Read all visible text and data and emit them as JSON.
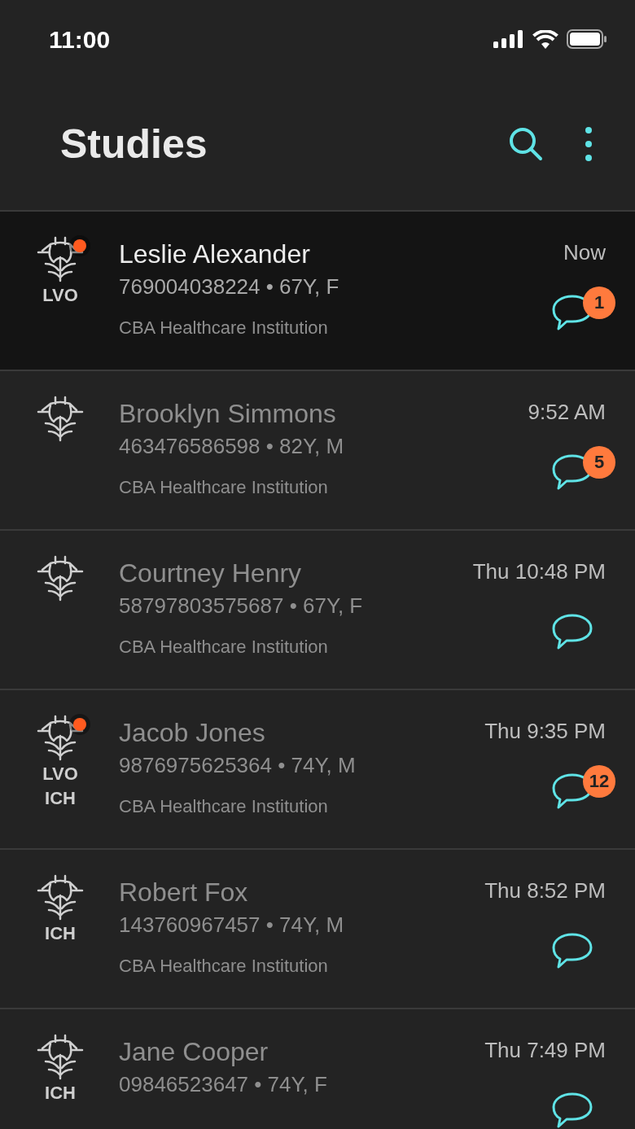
{
  "status_bar": {
    "time": "11:00"
  },
  "header": {
    "title": "Studies"
  },
  "studies": [
    {
      "name": "Leslie Alexander",
      "details": "769004038224 • 67Y, F",
      "institution": "CBA Healthcare Institution",
      "time": "Now",
      "selected": true,
      "unread": true,
      "tags": [
        "LVO"
      ],
      "message_count": "1"
    },
    {
      "name": "Brooklyn Simmons",
      "details": "463476586598 • 82Y, M",
      "institution": "CBA Healthcare Institution",
      "time": "9:52 AM",
      "selected": false,
      "unread": false,
      "message_count": "5"
    },
    {
      "name": "Courtney Henry",
      "details": "58797803575687 • 67Y, F",
      "institution": "CBA Healthcare Institution",
      "time": "Thu 10:48 PM",
      "selected": false,
      "unread": false
    },
    {
      "name": "Jacob Jones",
      "details": "9876975625364 • 74Y, M",
      "institution": "CBA Healthcare Institution",
      "time": "Thu 9:35 PM",
      "selected": false,
      "unread": true,
      "tags": [
        "LVO",
        "ICH"
      ],
      "message_count": "12"
    },
    {
      "name": "Robert Fox",
      "details": "143760967457 • 74Y, M",
      "institution": "CBA Healthcare Institution",
      "time": "Thu 8:52 PM",
      "selected": false,
      "unread": false,
      "tags": [
        "ICH"
      ]
    },
    {
      "name": "Jane Cooper",
      "details": "09846523647 • 74Y, F",
      "time": "Thu 7:49 PM",
      "selected": false,
      "unread": false,
      "tags": [
        "ICH"
      ]
    }
  ]
}
